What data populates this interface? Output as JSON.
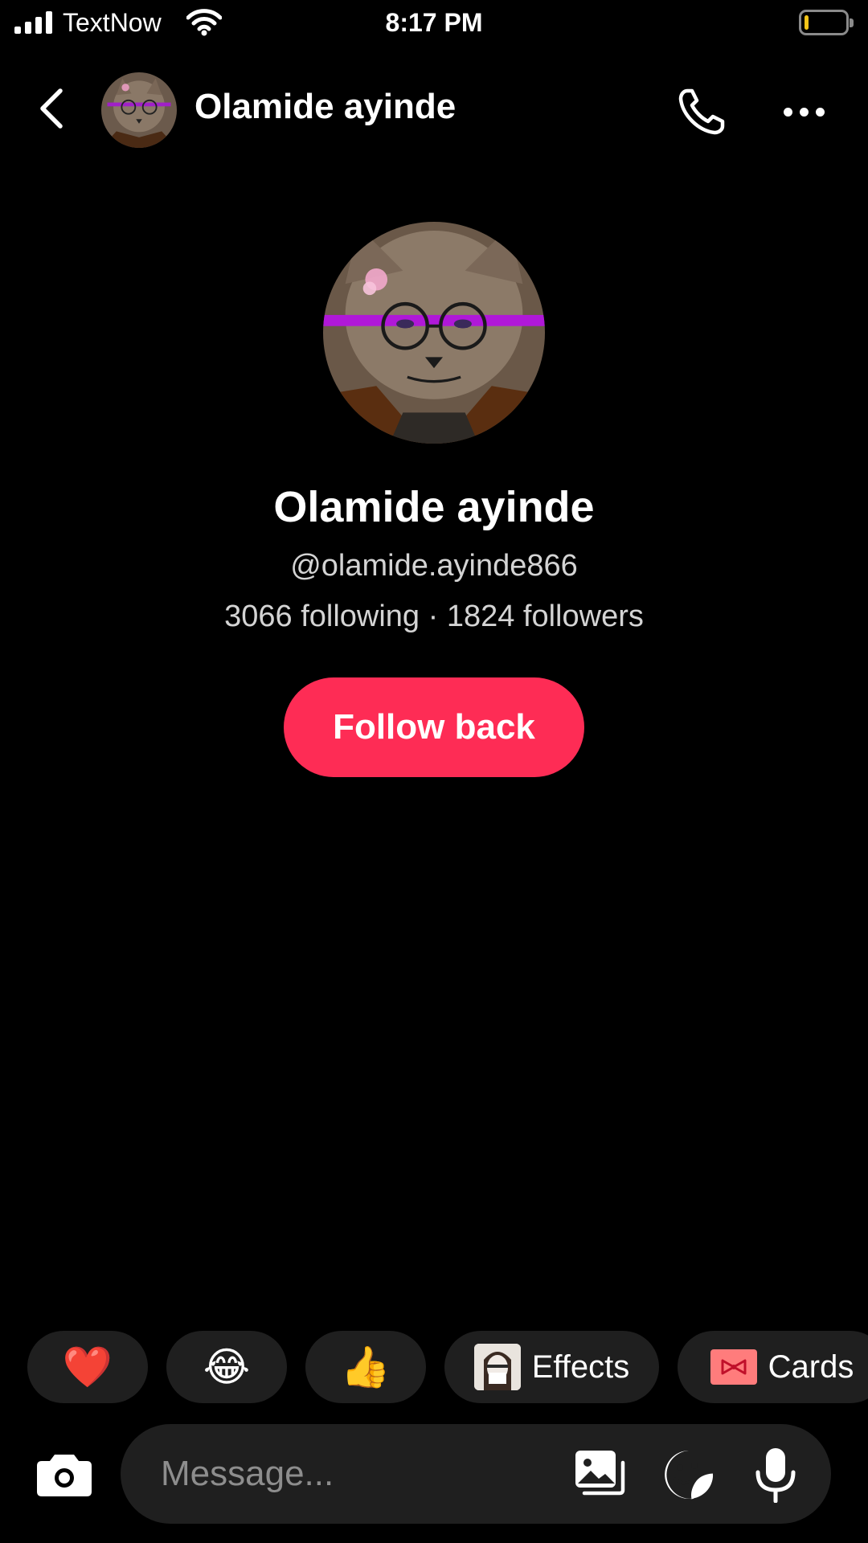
{
  "status_bar": {
    "carrier": "TextNow",
    "time": "8:17 PM",
    "battery_level": 0.1,
    "icons": [
      "signal-icon",
      "wifi-icon",
      "battery-icon"
    ]
  },
  "header": {
    "name": "Olamide ayinde",
    "icons": [
      "back-icon",
      "phone-icon",
      "more-icon"
    ]
  },
  "profile": {
    "name": "Olamide ayinde",
    "handle": "@olamide.ayinde866",
    "stats": "3066 following · 1824 followers",
    "follow_button": "Follow back"
  },
  "quick_reactions": {
    "heart": "❤️",
    "laugh": "😂",
    "thumbs_up": "👍",
    "effects_label": "Effects",
    "cards_label": "Cards"
  },
  "composer": {
    "placeholder": "Message...",
    "icons": [
      "camera-icon",
      "gallery-icon",
      "sticker-icon",
      "microphone-icon"
    ]
  },
  "colors": {
    "background": "#000000",
    "accent": "#fe2c55",
    "chip_background": "#1f1f1f",
    "secondary_text": "#d4d4d4",
    "battery_low": "#f5c518"
  }
}
